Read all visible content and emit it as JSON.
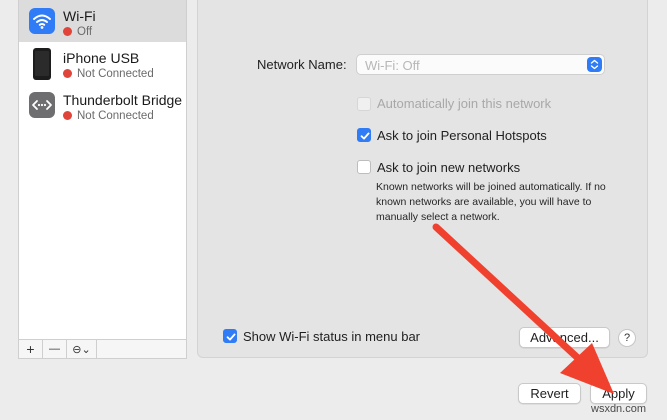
{
  "sidebar": {
    "services": [
      {
        "name": "Wi-Fi",
        "status": "Off",
        "icon": "wifi-icon",
        "selected": true
      },
      {
        "name": "iPhone USB",
        "status": "Not Connected",
        "icon": "iphone-icon",
        "selected": false
      },
      {
        "name": "Thunderbolt Bridge",
        "status": "Not Connected",
        "icon": "thunderbolt-bridge-icon",
        "selected": false
      }
    ],
    "toolbar": {
      "add": "+",
      "remove": "—",
      "action": "⊖⌄"
    }
  },
  "panel": {
    "network_name_label": "Network Name:",
    "network_name_value": "Wi-Fi: Off",
    "auto_join_label": "Automatically join this network",
    "personal_hotspots_label": "Ask to join Personal Hotspots",
    "new_networks_label": "Ask to join new networks",
    "note": "Known networks will be joined automatically. If no known networks are available, you will have to manually select a network.",
    "show_status_label": "Show Wi-Fi status in menu bar",
    "advanced_label": "Advanced...",
    "help_label": "?"
  },
  "footer": {
    "revert_label": "Revert",
    "apply_label": "Apply"
  },
  "watermark": "wsxdn.com",
  "colors": {
    "accent": "#2f7cf6",
    "status_red": "#e0443a",
    "arrow": "#f0412f"
  }
}
